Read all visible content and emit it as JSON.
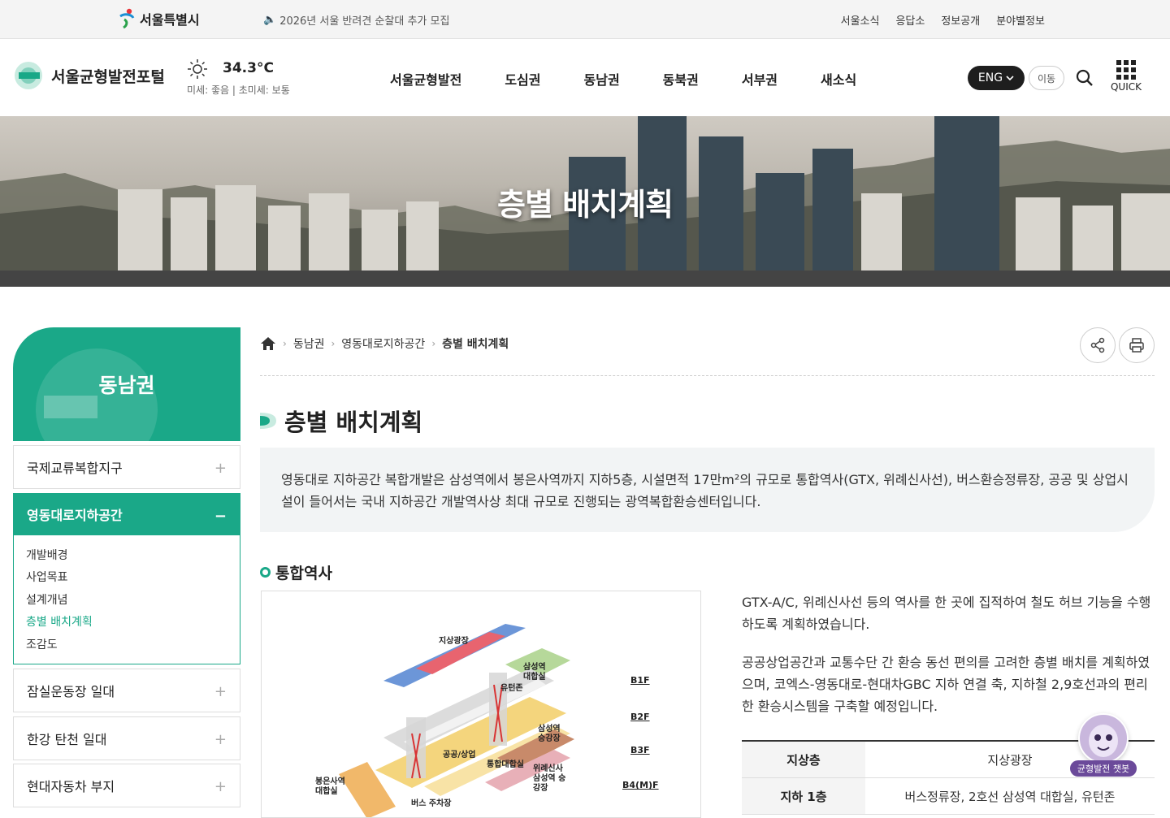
{
  "top": {
    "seoul_logo": "서울특별시",
    "notice": "2026년 서울 반려견 순찰대 추가 모집",
    "links": [
      "서울소식",
      "응답소",
      "정보공개",
      "분야별정보"
    ]
  },
  "header": {
    "portal_name": "서울균형발전포털",
    "weather_temp": "34.3°C",
    "weather_dust": "미세: 좋음  |  초미세: 보통",
    "gnb": [
      "서울균형발전",
      "도심권",
      "동남권",
      "동북권",
      "서부권",
      "새소식"
    ],
    "lang": "ENG",
    "go": "이동",
    "quick": "QUICK"
  },
  "hero": {
    "title": "층별 배치계획"
  },
  "lnb": {
    "title": "동남권",
    "items": [
      {
        "label": "국제교류복합지구",
        "sign": "+"
      },
      {
        "label": "영동대로지하공간",
        "sign": "−"
      },
      {
        "label": "잠실운동장 일대",
        "sign": "+"
      },
      {
        "label": "한강 탄천 일대",
        "sign": "+"
      },
      {
        "label": "현대자동차 부지",
        "sign": "+"
      }
    ],
    "sub": [
      "개발배경",
      "사업목표",
      "설계개념",
      "층별 배치계획",
      "조감도"
    ]
  },
  "breadcrumb": [
    "동남권",
    "영동대로지하공간",
    "층별 배치계획"
  ],
  "content": {
    "title": "층별 배치계획",
    "intro": "영동대로 지하공간 복합개발은 삼성역에서 봉은사역까지 지하5층, 시설면적 17만m²의 규모로 통합역사(GTX, 위례신사선), 버스환승정류장, 공공 및 상업시설이 들어서는 국내 지하공간 개발역사상 최대 규모로 진행되는 광역복합환승센터입니다.",
    "section": "통합역사",
    "desc1": "GTX-A/C, 위례신사선 등의 역사를 한 곳에 집적하여 철도 허브 기능을 수행하도록 계획하였습니다.",
    "desc2": "공공상업공간과 교통수단 간 환승 동선 편의를 고려한 층별 배치를 계획하였으며, 코엑스-영동대로-현대차GBC 지하 연결 축, 지하철 2,9호선과의 편리한 환승시스템을 구축할 예정입니다.",
    "table": [
      {
        "floor": "지상층",
        "desc": "지상광장"
      },
      {
        "floor": "지하 1층",
        "desc": "버스정류장, 2호선 삼성역 대합실, 유턴존"
      }
    ]
  },
  "diagram": {
    "labels": [
      "지상광장",
      "삼성역 대합실",
      "유턴존",
      "삼성역 승강장",
      "공공/상업",
      "통합대합실",
      "위례신사 삼성역 승강장",
      "봉은사역 대합실",
      "버스 주차장"
    ],
    "floors": [
      "B1F",
      "B2F",
      "B3F",
      "B4(M)F"
    ]
  },
  "chatbot": {
    "label": "균형발전 챗봇"
  },
  "colors": {
    "accent": "#1aa888"
  }
}
